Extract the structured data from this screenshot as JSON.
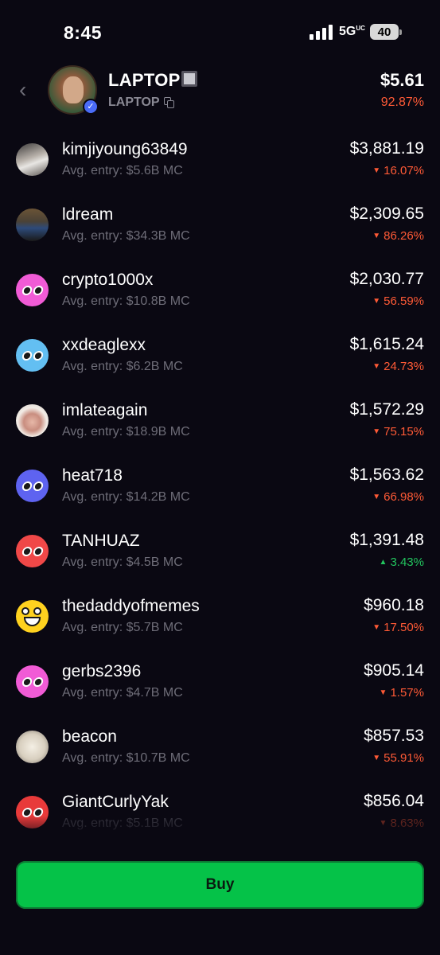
{
  "status_bar": {
    "time": "8:45",
    "network": "5G",
    "network_sup": "UC",
    "battery": "40"
  },
  "token": {
    "name": "LAPTOP",
    "ticker": "LAPTOP",
    "price": "$5.61",
    "change": "92.87%"
  },
  "holders": [
    {
      "name": "kimjiyoung63849",
      "entry": "Avg. entry: $5.6B MC",
      "amount": "$3,881.19",
      "change": "16.07%",
      "direction": "down",
      "avatar": "photo-1"
    },
    {
      "name": "ldream",
      "entry": "Avg. entry: $34.3B MC",
      "amount": "$2,309.65",
      "change": "86.26%",
      "direction": "down",
      "avatar": "photo-2"
    },
    {
      "name": "crypto1000x",
      "entry": "Avg. entry: $10.8B MC",
      "amount": "$2,030.77",
      "change": "56.59%",
      "direction": "down",
      "avatar": "logo",
      "avatar_color": "#f15bd6"
    },
    {
      "name": "xxdeaglexx",
      "entry": "Avg. entry: $6.2B MC",
      "amount": "$1,615.24",
      "change": "24.73%",
      "direction": "down",
      "avatar": "logo",
      "avatar_color": "#63bff2"
    },
    {
      "name": "imlateagain",
      "entry": "Avg. entry: $18.9B MC",
      "amount": "$1,572.29",
      "change": "75.15%",
      "direction": "down",
      "avatar": "photo-3"
    },
    {
      "name": "heat718",
      "entry": "Avg. entry: $14.2B MC",
      "amount": "$1,563.62",
      "change": "66.98%",
      "direction": "down",
      "avatar": "logo",
      "avatar_color": "#5e63f0"
    },
    {
      "name": "TANHUAZ",
      "entry": "Avg. entry: $4.5B MC",
      "amount": "$1,391.48",
      "change": "3.43%",
      "direction": "up",
      "avatar": "logo",
      "avatar_color": "#f04848"
    },
    {
      "name": "thedaddyofmemes",
      "entry": "Avg. entry: $5.7B MC",
      "amount": "$960.18",
      "change": "17.50%",
      "direction": "down",
      "avatar": "emoji"
    },
    {
      "name": "gerbs2396",
      "entry": "Avg. entry: $4.7B MC",
      "amount": "$905.14",
      "change": "1.57%",
      "direction": "down",
      "avatar": "logo",
      "avatar_color": "#f15bd6"
    },
    {
      "name": "beacon",
      "entry": "Avg. entry: $10.7B MC",
      "amount": "$857.53",
      "change": "55.91%",
      "direction": "down",
      "avatar": "photo-4"
    },
    {
      "name": "GiantCurlyYak",
      "entry": "Avg. entry: $5.1B MC",
      "amount": "$856.04",
      "change": "8.63%",
      "direction": "down",
      "avatar": "logo",
      "avatar_color": "#e83a3a",
      "faded": true
    }
  ],
  "buy_button": {
    "label": "Buy",
    "color": "#05c248"
  },
  "colors": {
    "background": "#0a0812",
    "negative": "#ff5a36",
    "positive": "#22c55e",
    "muted": "#6e6d78"
  }
}
